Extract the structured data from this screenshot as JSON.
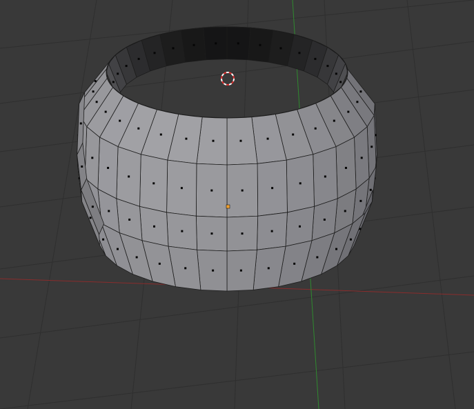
{
  "viewport": {
    "kind": "3d-viewport",
    "background_color": "#393939",
    "grid_line_color": "#2f2f2f",
    "axis_x_color": "#8a2c2c",
    "axis_y_color": "#2f8a2f"
  },
  "mesh": {
    "shape": "open-cylinder-barrel",
    "mode": "edit",
    "select_mode": "face",
    "segments": 32,
    "face_color_light": "#a2a2a6",
    "face_color_dark": "#4d4d53",
    "interior_color": "#161616",
    "edge_color": "#1c1c1c",
    "face_dot_color": "#050505"
  },
  "selection": {
    "active_dot_color": "#f0a030"
  },
  "cursor_3d": {
    "icon": "3d-cursor-icon",
    "ring_color_a": "#e03030",
    "ring_color_b": "#ffffff"
  }
}
